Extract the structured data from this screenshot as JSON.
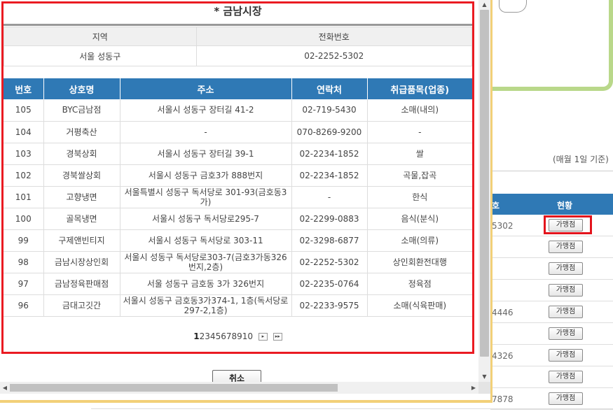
{
  "popup": {
    "title": "* 금남시장",
    "info_headers": [
      "지역",
      "전화번호"
    ],
    "info_values": [
      "서울 성동구",
      "02-2252-5302"
    ],
    "columns": [
      "번호",
      "상호명",
      "주소",
      "연락처",
      "취급품목(업종)"
    ],
    "rows": [
      [
        "105",
        "BYC금남점",
        "서울시 성동구 장터길 41-2",
        "02-719-5430",
        "소매(내의)"
      ],
      [
        "104",
        "거평축산",
        "-",
        "070-8269-9200",
        "-"
      ],
      [
        "103",
        "경북상회",
        "서울시 성동구 장터길 39-1",
        "02-2234-1852",
        "쌀"
      ],
      [
        "102",
        "경북쌀상회",
        "서울시 성동구 금호3가 888번지",
        "02-2234-1852",
        "곡물,잡곡"
      ],
      [
        "101",
        "고향냉면",
        "서울특별시 성동구 독서당로 301-93(금호동3가)",
        "-",
        "한식"
      ],
      [
        "100",
        "골목냉면",
        "서울시 성동구 독서당로295-7",
        "02-2299-0883",
        "음식(분식)"
      ],
      [
        "99",
        "구제앤빈티지",
        "서울시 성동구 독서당로 303-11",
        "02-3298-6877",
        "소매(의류)"
      ],
      [
        "98",
        "금남시장상인회",
        "서울시 성동구 독서당로303-7(금호3가동326번지,2층)",
        "02-2252-5302",
        "상인회환전대행"
      ],
      [
        "97",
        "금남정육판매점",
        "서울 성동구 금호동 3가 326번지",
        "02-2235-0764",
        "정육점"
      ],
      [
        "96",
        "금대고깃간",
        "서울시 성동구 금호동3가374-1, 1층(독서당로297-2,1층)",
        "02-2233-9575",
        "소매(식육판매)"
      ]
    ],
    "pager": {
      "current": "1",
      "pages": [
        "2",
        "3",
        "4",
        "5",
        "6",
        "7",
        "8",
        "9",
        "10"
      ],
      "next": "▸",
      "last": "▸▸"
    },
    "cancel_label": "취소"
  },
  "background": {
    "note": "(매월 1일 기준)",
    "col_headers": [
      "호",
      "현황"
    ],
    "button_label": "가맹점",
    "phone_fragments": [
      "5302",
      "",
      "",
      "",
      "4446",
      "",
      "4326",
      "",
      "7878"
    ],
    "highlight_color": "#e3141c"
  },
  "scroll": {
    "up": "▲",
    "down": "▼",
    "left": "◀",
    "right": "▶"
  },
  "colors": {
    "header_blue": "#2f79b5",
    "frame_red": "#ea1b22",
    "window_border": "#f2d078",
    "map_green": "#b9d88a"
  }
}
